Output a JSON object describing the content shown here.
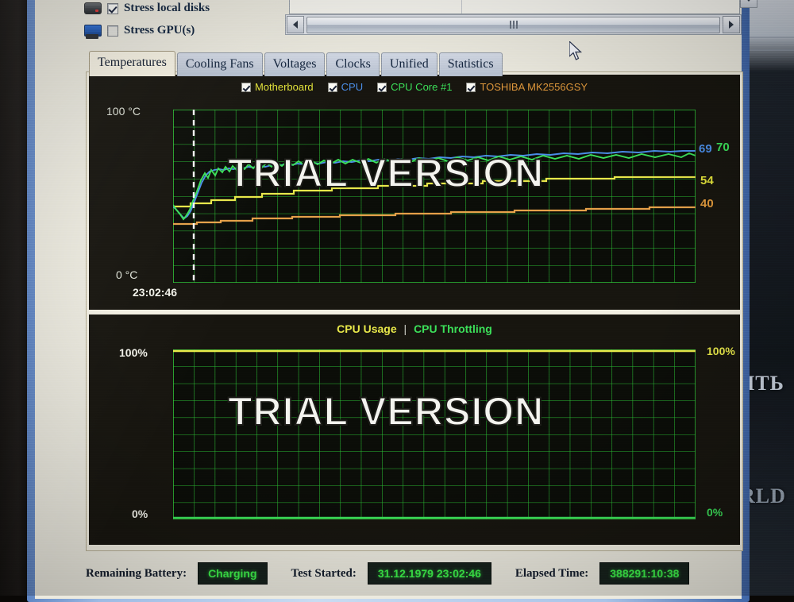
{
  "window": {
    "options": [
      {
        "label": "Stress local disks",
        "checked": true,
        "icon": "disk-icon"
      },
      {
        "label": "Stress GPU(s)",
        "checked": false,
        "icon": "gpu-icon"
      }
    ]
  },
  "tabs": [
    {
      "label": "Temperatures",
      "active": true
    },
    {
      "label": "Cooling Fans",
      "active": false
    },
    {
      "label": "Voltages",
      "active": false
    },
    {
      "label": "Clocks",
      "active": false
    },
    {
      "label": "Unified",
      "active": false
    },
    {
      "label": "Statistics",
      "active": false
    }
  ],
  "temperature_chart": {
    "legend": [
      {
        "label": "Motherboard",
        "color": "#e2e23a",
        "checked": true
      },
      {
        "label": "CPU",
        "color": "#4b7fe8",
        "checked": true
      },
      {
        "label": "CPU Core #1",
        "color": "#3ce05a",
        "checked": true
      },
      {
        "label": "TOSHIBA MK2556GSY",
        "color": "#e09a3c",
        "checked": true
      }
    ],
    "y_top": "100 °C",
    "y_bottom": "0 °C",
    "x_start": "23:02:46",
    "current_values": [
      {
        "label": "69",
        "color": "#4b7fe8"
      },
      {
        "label": "70",
        "color": "#3ce05a"
      },
      {
        "label": "54",
        "color": "#e2e23a"
      },
      {
        "label": "40",
        "color": "#e09a3c"
      }
    ],
    "watermark": "TRIAL VERSION"
  },
  "usage_chart": {
    "title_primary": "CPU Usage",
    "title_separator": "|",
    "title_secondary": "CPU Throttling",
    "primary_color": "#e2e23a",
    "secondary_color": "#3ce05a",
    "y_top_left": "100%",
    "y_bottom_left": "0%",
    "y_top_right": "100%",
    "y_bottom_right": "0%",
    "watermark": "TRIAL VERSION"
  },
  "status": {
    "battery_label": "Remaining Battery:",
    "battery_value": "Charging",
    "started_label": "Test Started:",
    "started_value": "31.12.1979 23:02:46",
    "elapsed_label": "Elapsed Time:",
    "elapsed_value": "388291:10:38"
  },
  "background": {
    "text_a": "ИТЬ",
    "text_b": "RLD"
  },
  "chart_data": [
    {
      "type": "line",
      "title": "Temperatures",
      "xlabel": "",
      "ylabel": "°C",
      "ylim": [
        0,
        100
      ],
      "x_start_label": "23:02:46",
      "grid": true,
      "legend_position": "top-center",
      "series": [
        {
          "name": "Motherboard",
          "color": "#e2e23a",
          "current": 54,
          "values": [
            44,
            44,
            45,
            45,
            46,
            46,
            47,
            47,
            48,
            48,
            48,
            49,
            49,
            49,
            50,
            50,
            50,
            50,
            51,
            51,
            51,
            51,
            52,
            52,
            52,
            52,
            52,
            53,
            53,
            53,
            53,
            53,
            53,
            54,
            54,
            54,
            54,
            54,
            54,
            54
          ]
        },
        {
          "name": "CPU",
          "color": "#4b7fe8",
          "current": 69,
          "values": [
            44,
            42,
            40,
            38,
            37,
            39,
            44,
            52,
            58,
            61,
            63,
            64,
            64,
            65,
            65,
            65,
            65,
            66,
            66,
            66,
            66,
            66,
            67,
            67,
            67,
            67,
            67,
            67,
            68,
            68,
            68,
            68,
            68,
            68,
            69,
            69,
            69,
            69,
            69,
            69
          ]
        },
        {
          "name": "CPU Core #1",
          "color": "#3ce05a",
          "current": 70,
          "values": [
            45,
            43,
            41,
            39,
            38,
            40,
            45,
            53,
            59,
            62,
            64,
            65,
            65,
            66,
            66,
            66,
            66,
            67,
            67,
            67,
            67,
            67,
            68,
            68,
            68,
            68,
            68,
            68,
            69,
            69,
            69,
            69,
            69,
            69,
            70,
            70,
            70,
            70,
            70,
            70
          ]
        },
        {
          "name": "TOSHIBA MK2556GSY",
          "color": "#e09a3c",
          "current": 40,
          "values": [
            34,
            34,
            34,
            35,
            35,
            35,
            36,
            36,
            36,
            36,
            37,
            37,
            37,
            37,
            37,
            37,
            38,
            38,
            38,
            38,
            38,
            38,
            38,
            38,
            39,
            39,
            39,
            39,
            39,
            39,
            39,
            39,
            39,
            40,
            40,
            40,
            40,
            40,
            40,
            40
          ]
        }
      ],
      "annotations": [
        {
          "type": "vline",
          "style": "dashed",
          "color": "#ffffff",
          "x_fraction": 0.04
        },
        {
          "type": "watermark",
          "text": "TRIAL VERSION"
        }
      ]
    },
    {
      "type": "line",
      "title": "CPU Usage | CPU Throttling",
      "xlabel": "",
      "ylabel": "%",
      "ylim": [
        0,
        100
      ],
      "grid": true,
      "legend_position": "top-center",
      "series": [
        {
          "name": "CPU Usage",
          "color": "#e2e23a",
          "current": 100,
          "constant": 100
        },
        {
          "name": "CPU Throttling",
          "color": "#3ce05a",
          "current": 0,
          "constant": 0
        }
      ],
      "annotations": [
        {
          "type": "watermark",
          "text": "TRIAL VERSION"
        }
      ]
    }
  ]
}
